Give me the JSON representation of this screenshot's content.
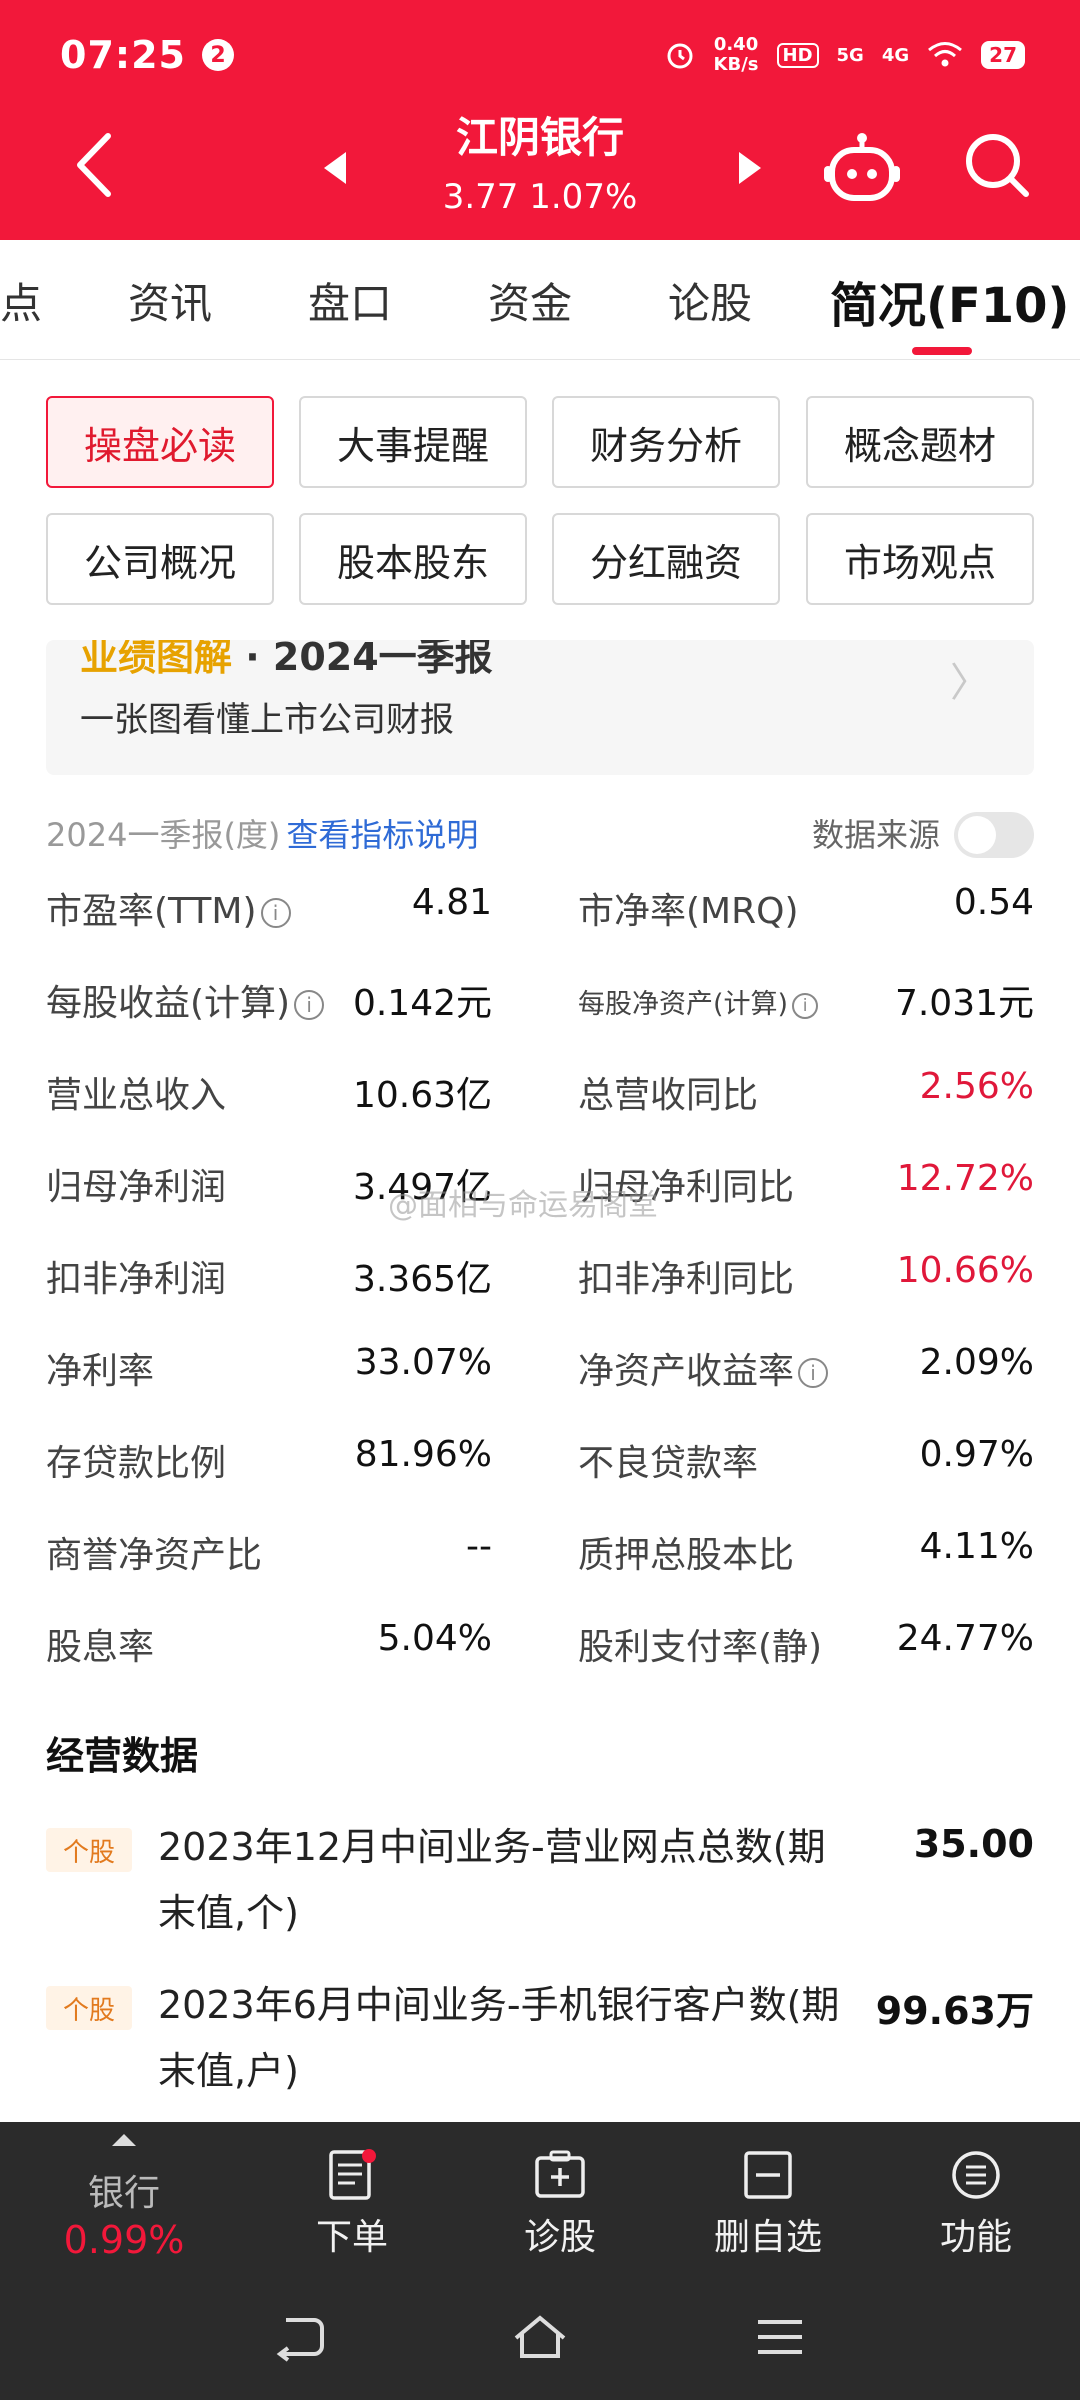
{
  "status_bar": {
    "time": "07:25",
    "notif_count": "2",
    "speed_value": "0.40",
    "speed_unit": "KB/s",
    "hd": "HD",
    "sig1": "5G",
    "sig2": "4G",
    "battery": "27"
  },
  "header": {
    "stock_name": "江阴银行",
    "quote": "3.77 1.07%",
    "bg_color": "#f2183a"
  },
  "tabs": [
    {
      "label": "点"
    },
    {
      "label": "资讯"
    },
    {
      "label": "盘口"
    },
    {
      "label": "资金"
    },
    {
      "label": "论股"
    },
    {
      "label": "简况(F10)",
      "active": true
    }
  ],
  "buttons": [
    {
      "label": "操盘必读",
      "active": true
    },
    {
      "label": "大事提醒"
    },
    {
      "label": "财务分析"
    },
    {
      "label": "概念题材"
    },
    {
      "label": "公司概况"
    },
    {
      "label": "股本股东"
    },
    {
      "label": "分红融资"
    },
    {
      "label": "市场观点"
    }
  ],
  "banner": {
    "title_prefix": "业绩图解",
    "title_rest": "· 2024一季报",
    "subtitle": "一张图看懂上市公司财报",
    "chevron": "〉"
  },
  "period": {
    "label": "2024一季报(度)",
    "link": "查看指标说明",
    "source_label": "数据来源"
  },
  "metrics": [
    {
      "l_label": "市盈率(TTM)",
      "l_info": true,
      "l_value": "4.81",
      "r_label": "市净率(MRQ)",
      "r_value": "0.54"
    },
    {
      "l_label": "每股收益(计算)",
      "l_info": true,
      "l_value": "0.142元",
      "r_label": "每股净资产(计算)",
      "r_info": true,
      "r_small": true,
      "r_value": "7.031元"
    },
    {
      "l_label": "营业总收入",
      "l_value": "10.63亿",
      "r_label": "总营收同比",
      "r_value": "2.56%",
      "r_red": true
    },
    {
      "l_label": "归母净利润",
      "l_value": "3.497亿",
      "r_label": "归母净利同比",
      "r_value": "12.72%",
      "r_red": true
    },
    {
      "l_label": "扣非净利润",
      "l_value": "3.365亿",
      "r_label": "扣非净利同比",
      "r_value": "10.66%",
      "r_red": true
    },
    {
      "l_label": "净利率",
      "l_value": "33.07%",
      "r_label": "净资产收益率",
      "r_info": true,
      "r_value": "2.09%"
    },
    {
      "l_label": "存贷款比例",
      "l_value": "81.96%",
      "r_label": "不良贷款率",
      "r_value": "0.97%"
    },
    {
      "l_label": "商誉净资产比",
      "l_value": "--",
      "r_label": "质押总股本比",
      "r_value": "4.11%"
    },
    {
      "l_label": "股息率",
      "l_value": "5.04%",
      "r_label": "股利支付率(静)",
      "r_value": "24.77%"
    }
  ],
  "watermark": "@面相与命运易阁堂",
  "operating": {
    "title": "经营数据",
    "items": [
      {
        "tag": "个股",
        "text": "2023年12月中间业务-营业网点总数(期末值,个)",
        "value": "35.00"
      },
      {
        "tag": "个股",
        "text": "2023年6月中间业务-手机银行客户数(期末值,户)",
        "value": "99.63万"
      }
    ]
  },
  "bottom_bar": {
    "sector_label": "银行",
    "sector_pct": "0.99%",
    "items": [
      {
        "label": "下单",
        "icon": "order-icon"
      },
      {
        "label": "诊股",
        "icon": "diagnose-icon"
      },
      {
        "label": "删自选",
        "icon": "remove-watchlist-icon"
      },
      {
        "label": "功能",
        "icon": "menu-icon"
      }
    ]
  }
}
